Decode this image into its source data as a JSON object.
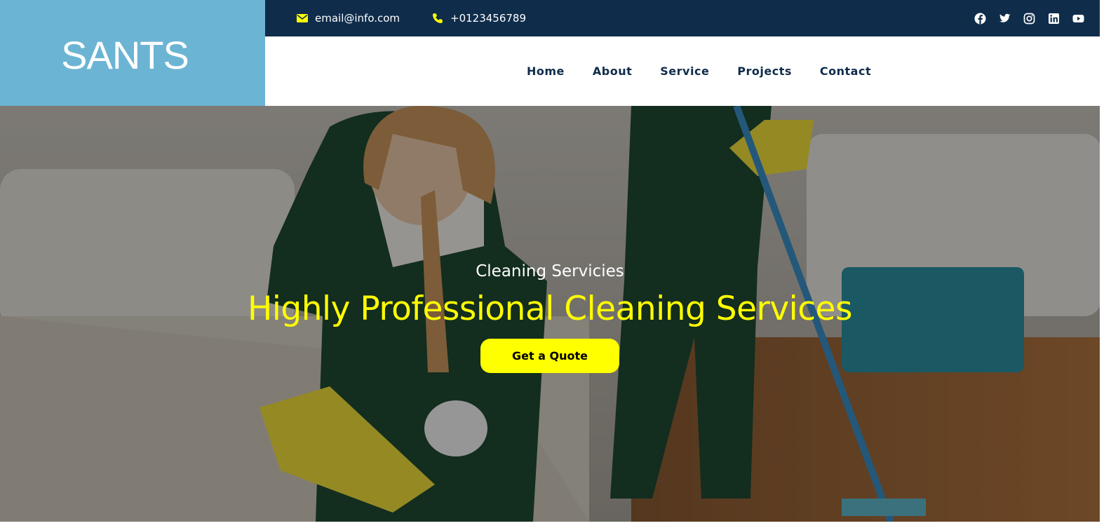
{
  "brand": {
    "name": "SANTS",
    "accent": "#6cb4d3",
    "dark": "#0f2c4b",
    "highlight": "#ffff00"
  },
  "topbar": {
    "email": "email@info.com",
    "phone": "+0123456789",
    "socials": [
      "facebook-icon",
      "twitter-icon",
      "instagram-icon",
      "linkedin-icon",
      "youtube-icon"
    ]
  },
  "nav": {
    "items": [
      {
        "label": "Home"
      },
      {
        "label": "About"
      },
      {
        "label": "Service"
      },
      {
        "label": "Projects"
      },
      {
        "label": "Contact"
      }
    ]
  },
  "hero": {
    "subtitle": "Cleaning Servicies",
    "title": "Highly Professional Cleaning Services",
    "cta": "Get a Quote"
  }
}
